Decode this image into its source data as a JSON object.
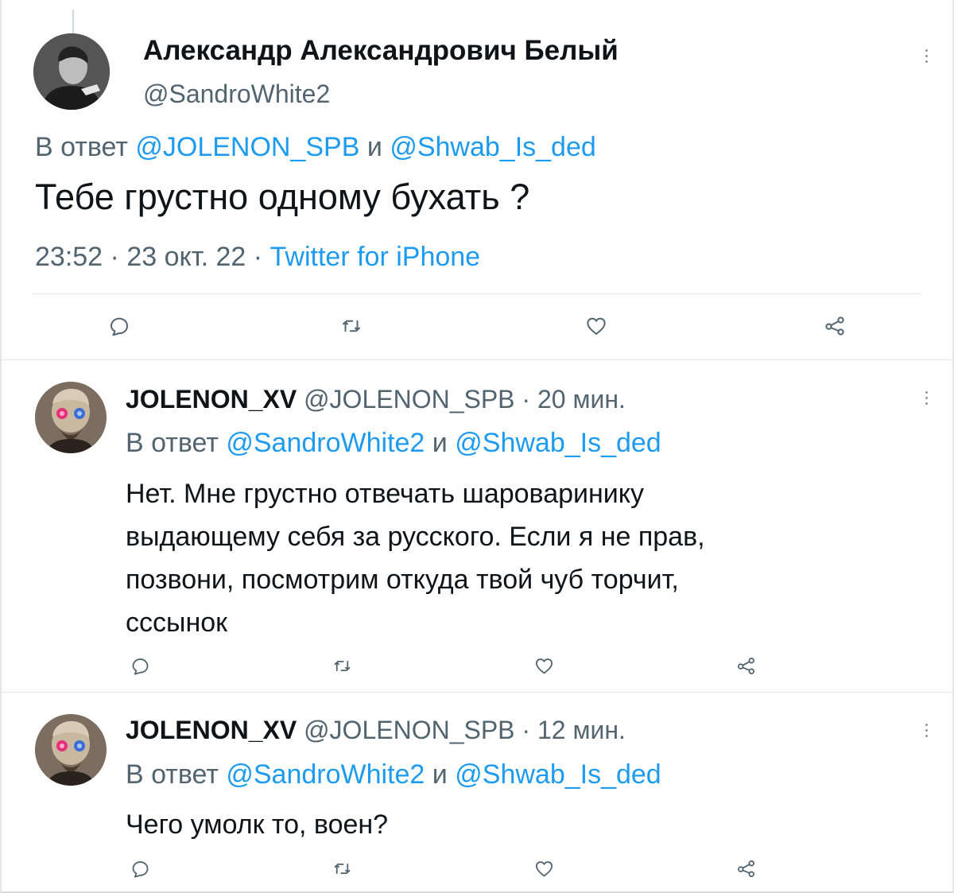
{
  "main_tweet": {
    "author_name": "Александр Александрович Белый",
    "handle": "@SandroWhite2",
    "reply_prefix": "В ответ",
    "reply_mention_1": "@JOLENON_SPB",
    "reply_joiner": "и",
    "reply_mention_2": "@Shwab_Is_ded",
    "text": "Тебе грустно одному бухать ?",
    "time": "23:52",
    "date": "23 окт. 22",
    "source": "Twitter for iPhone",
    "separator": "·"
  },
  "replies": [
    {
      "author_name": "JOLENON_XV",
      "handle": "@JOLENON_SPB",
      "age": "20 мин.",
      "reply_prefix": "В ответ",
      "reply_mention_1": "@SandroWhite2",
      "reply_joiner": "и",
      "reply_mention_2": "@Shwab_Is_ded",
      "text_lines": [
        "Нет. Мне грустно отвечать шароваринику",
        "выдающему себя за русского. Если я не прав,",
        "позвони, посмотрим откуда твой чуб торчит,",
        "сссынок"
      ]
    },
    {
      "author_name": "JOLENON_XV",
      "handle": "@JOLENON_SPB",
      "age": "12 мин.",
      "reply_prefix": "В ответ",
      "reply_mention_1": "@SandroWhite2",
      "reply_joiner": "и",
      "reply_mention_2": "@Shwab_Is_ded",
      "text_lines": [
        "Чего умолк то, воен?"
      ]
    }
  ],
  "icons": {
    "reply": "reply-bubble-icon",
    "retweet": "retweet-icon",
    "like": "heart-icon",
    "share": "share-nodes-icon",
    "more": "more-vertical-icon"
  },
  "colors": {
    "accent": "#1d9bf0",
    "secondary_text": "#536471",
    "primary_text": "#0f1419",
    "divider": "#e1e8ed"
  }
}
